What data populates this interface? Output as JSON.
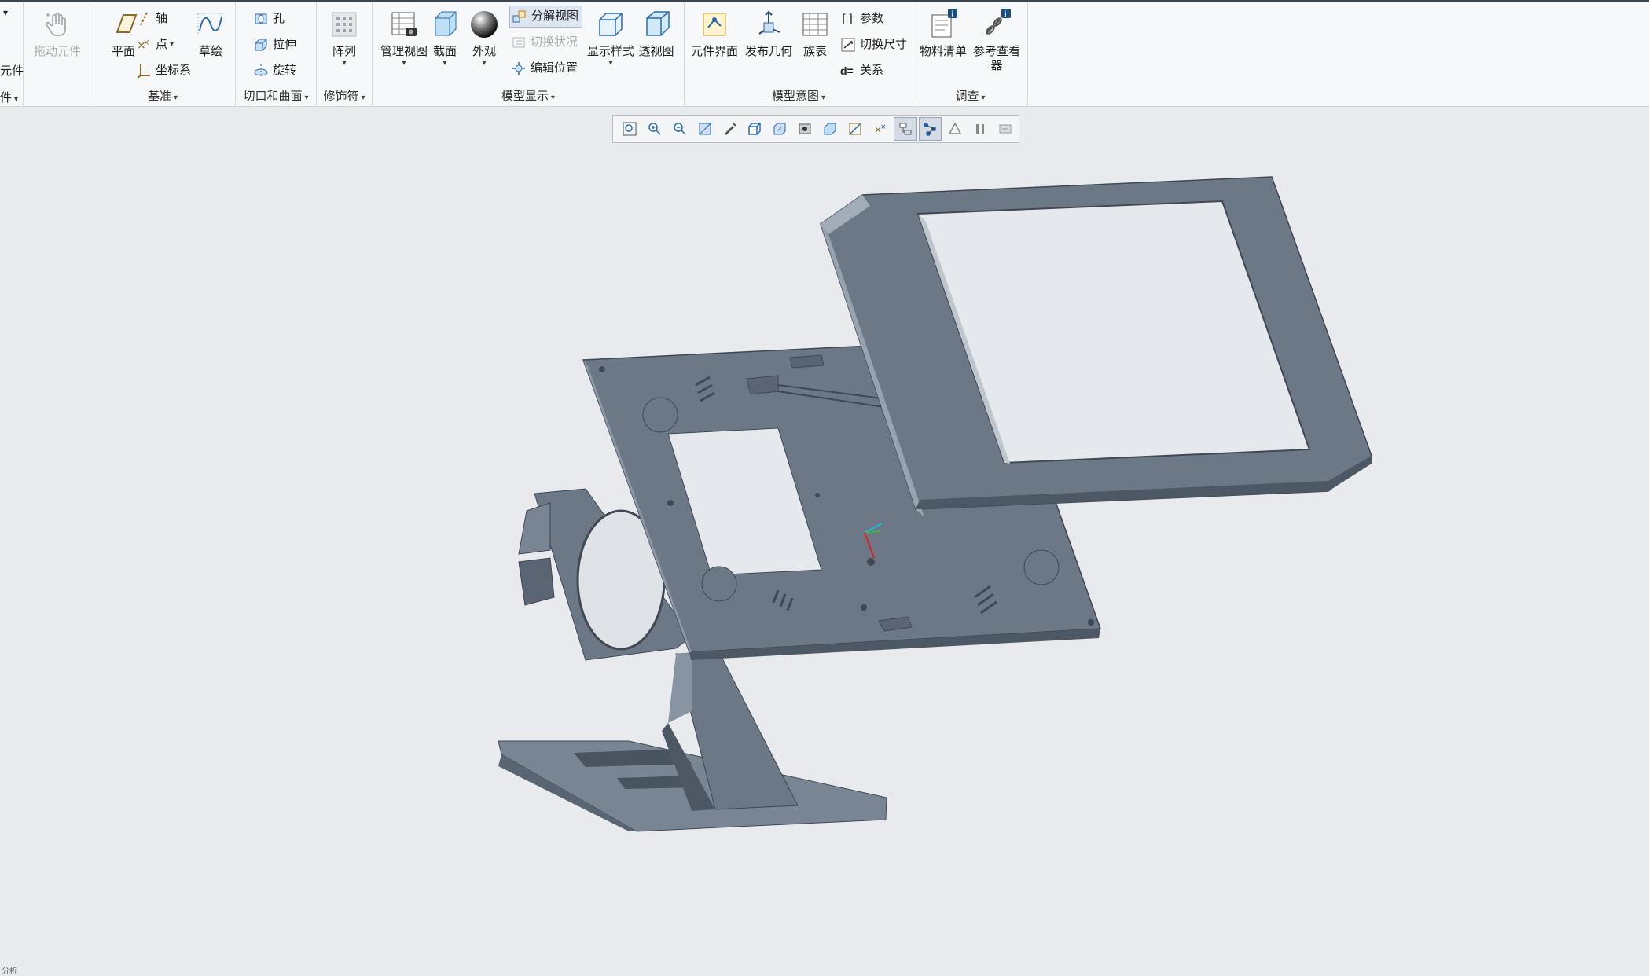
{
  "ribbon": {
    "left_cut": {
      "top_arrow": "▾",
      "label1": "元件",
      "label2": "件"
    },
    "operations": {
      "drag_label": "拖动元件"
    },
    "datum": {
      "group_label": "基准",
      "plane_label": "平面",
      "axis_label": "轴",
      "point_label": "点",
      "csys_label": "坐标系",
      "sketch_label": "草绘"
    },
    "cut_surface": {
      "group_label": "切口和曲面",
      "hole_label": "孔",
      "extrude_label": "拉伸",
      "revolve_label": "旋转"
    },
    "modifier": {
      "group_label": "修饰符",
      "pattern_label": "阵列"
    },
    "model_display": {
      "group_label": "模型显示",
      "manage_views_label": "管理视图",
      "section_label": "截面",
      "appearance_label": "外观",
      "exploded_view_label": "分解视图",
      "toggle_status_label": "切换状况",
      "edit_position_label": "编辑位置",
      "display_style_label": "显示样式",
      "perspective_label": "透视图"
    },
    "model_intent": {
      "group_label": "模型意图",
      "component_interface_label": "元件界面",
      "publish_geometry_label": "发布几何",
      "family_table_label": "族表",
      "parameters_label": "参数",
      "switch_dimensions_label": "切换尺寸",
      "relations_label": "关系"
    },
    "investigate": {
      "group_label": "调查",
      "bom_label": "物料清单",
      "reference_viewer_label": "参考查看器"
    }
  },
  "view_toolbar": {
    "buttons": [
      "refit-icon",
      "zoom-in-icon",
      "zoom-out-icon",
      "repaint-icon",
      "spin-center-icon",
      "saved-orientations-icon",
      "named-views-icon",
      "display-style-icon",
      "appearance-gallery-icon",
      "datum-display-icon",
      "annotation-display-icon",
      "show-tree-icon",
      "explode-icon",
      "section-icon",
      "pause-icon",
      "toggle-icon"
    ],
    "active": [
      "show-tree-icon",
      "explode-icon"
    ]
  },
  "status": {
    "corner_text": "分析"
  },
  "colors": {
    "model_fill": "#6d7886",
    "model_light": "#a3adba",
    "model_dark": "#4e5864",
    "background": "#e9eaee",
    "accent": "#2a6bb0"
  }
}
